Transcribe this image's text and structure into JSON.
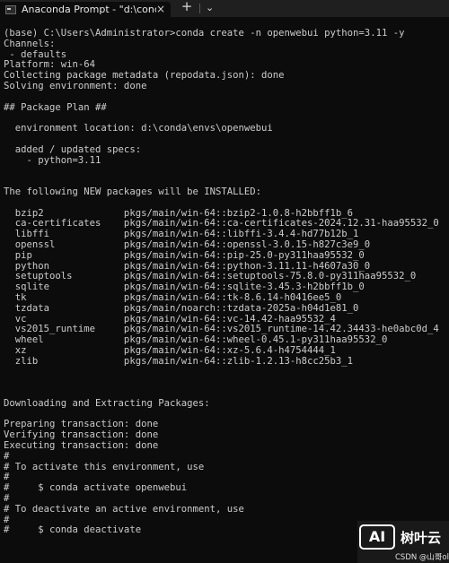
{
  "tab": {
    "title": "Anaconda Prompt - \"d:\\conda",
    "close": "×"
  },
  "toolbar": {
    "new_tab": "+",
    "dropdown": "⌄"
  },
  "terminal": {
    "lines": [
      "(base) C:\\Users\\Administrator>conda create -n openwebui python=3.11 -y",
      "Channels:",
      " - defaults",
      "Platform: win-64",
      "Collecting package metadata (repodata.json): done",
      "Solving environment: done",
      "",
      "## Package Plan ##",
      "",
      "  environment location: d:\\conda\\envs\\openwebui",
      "",
      "  added / updated specs:",
      "    - python=3.11",
      "",
      "",
      "The following NEW packages will be INSTALLED:",
      "",
      "  bzip2              pkgs/main/win-64::bzip2-1.0.8-h2bbff1b_6",
      "  ca-certificates    pkgs/main/win-64::ca-certificates-2024.12.31-haa95532_0",
      "  libffi             pkgs/main/win-64::libffi-3.4.4-hd77b12b_1",
      "  openssl            pkgs/main/win-64::openssl-3.0.15-h827c3e9_0",
      "  pip                pkgs/main/win-64::pip-25.0-py311haa95532_0",
      "  python             pkgs/main/win-64::python-3.11.11-h4607a30_0",
      "  setuptools         pkgs/main/win-64::setuptools-75.8.0-py311haa95532_0",
      "  sqlite             pkgs/main/win-64::sqlite-3.45.3-h2bbff1b_0",
      "  tk                 pkgs/main/win-64::tk-8.6.14-h0416ee5_0",
      "  tzdata             pkgs/main/noarch::tzdata-2025a-h04d1e81_0",
      "  vc                 pkgs/main/win-64::vc-14.42-haa95532_4",
      "  vs2015_runtime     pkgs/main/win-64::vs2015_runtime-14.42.34433-he0abc0d_4",
      "  wheel              pkgs/main/win-64::wheel-0.45.1-py311haa95532_0",
      "  xz                 pkgs/main/win-64::xz-5.6.4-h4754444_1",
      "  zlib               pkgs/main/win-64::zlib-1.2.13-h8cc25b3_1",
      "",
      "",
      "",
      "Downloading and Extracting Packages:",
      "",
      "Preparing transaction: done",
      "Verifying transaction: done",
      "Executing transaction: done",
      "#",
      "# To activate this environment, use",
      "#",
      "#     $ conda activate openwebui",
      "#",
      "# To deactivate an active environment, use",
      "#",
      "#     $ conda deactivate"
    ]
  },
  "watermark": {
    "badge": "AI",
    "name": "树叶云",
    "credit": "CSDN @山哥ol"
  }
}
